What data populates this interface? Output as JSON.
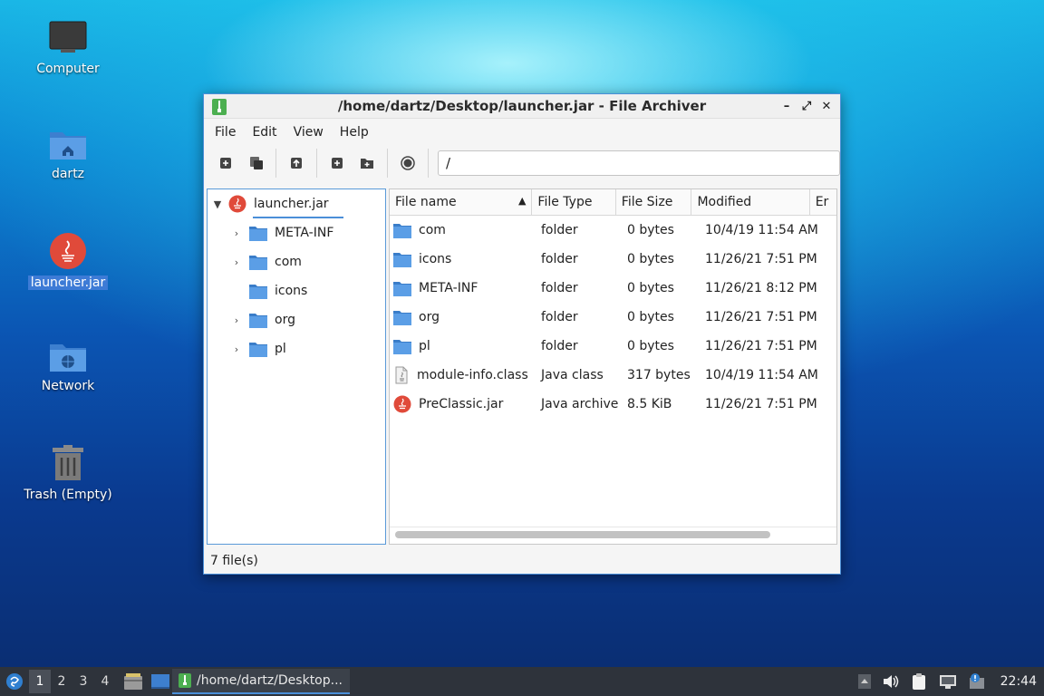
{
  "desktop": {
    "icons": [
      {
        "label": "Computer"
      },
      {
        "label": "dartz"
      },
      {
        "label": "launcher.jar"
      },
      {
        "label": "Network"
      },
      {
        "label": "Trash (Empty)"
      }
    ]
  },
  "window": {
    "title": "/home/dartz/Desktop/launcher.jar - File Archiver",
    "menu": [
      "File",
      "Edit",
      "View",
      "Help"
    ],
    "location": "/",
    "tree": {
      "root": "launcher.jar",
      "children": [
        "META-INF",
        "com",
        "icons",
        "org",
        "pl"
      ]
    },
    "columns": [
      "File name",
      "File Type",
      "File Size",
      "Modified",
      "Er"
    ],
    "files": [
      {
        "name": "com",
        "type": "folder",
        "size": "0 bytes",
        "modified": "10/4/19 11:54 AM",
        "icon": "folder-icon"
      },
      {
        "name": "icons",
        "type": "folder",
        "size": "0 bytes",
        "modified": "11/26/21 7:51 PM",
        "icon": "folder-icon"
      },
      {
        "name": "META-INF",
        "type": "folder",
        "size": "0 bytes",
        "modified": "11/26/21 8:12 PM",
        "icon": "folder-icon"
      },
      {
        "name": "org",
        "type": "folder",
        "size": "0 bytes",
        "modified": "11/26/21 7:51 PM",
        "icon": "folder-icon"
      },
      {
        "name": "pl",
        "type": "folder",
        "size": "0 bytes",
        "modified": "11/26/21 7:51 PM",
        "icon": "folder-icon"
      },
      {
        "name": "module-info.class",
        "type": "Java class",
        "size": "317 bytes",
        "modified": "10/4/19 11:54 AM",
        "icon": "java-class-icon"
      },
      {
        "name": "PreClassic.jar",
        "type": "Java archive",
        "size": "8.5 KiB",
        "modified": "11/26/21 7:51 PM",
        "icon": "java-archive-icon"
      }
    ],
    "status": "7 file(s)"
  },
  "taskbar": {
    "workspaces": [
      "1",
      "2",
      "3",
      "4"
    ],
    "task_label": "/home/dartz/Desktop...",
    "clock": "22:44"
  },
  "colors": {
    "accent": "#4a8fd8",
    "folder": "#4a90d9",
    "java": "#e04a3a",
    "taskbar": "#2e333b"
  }
}
